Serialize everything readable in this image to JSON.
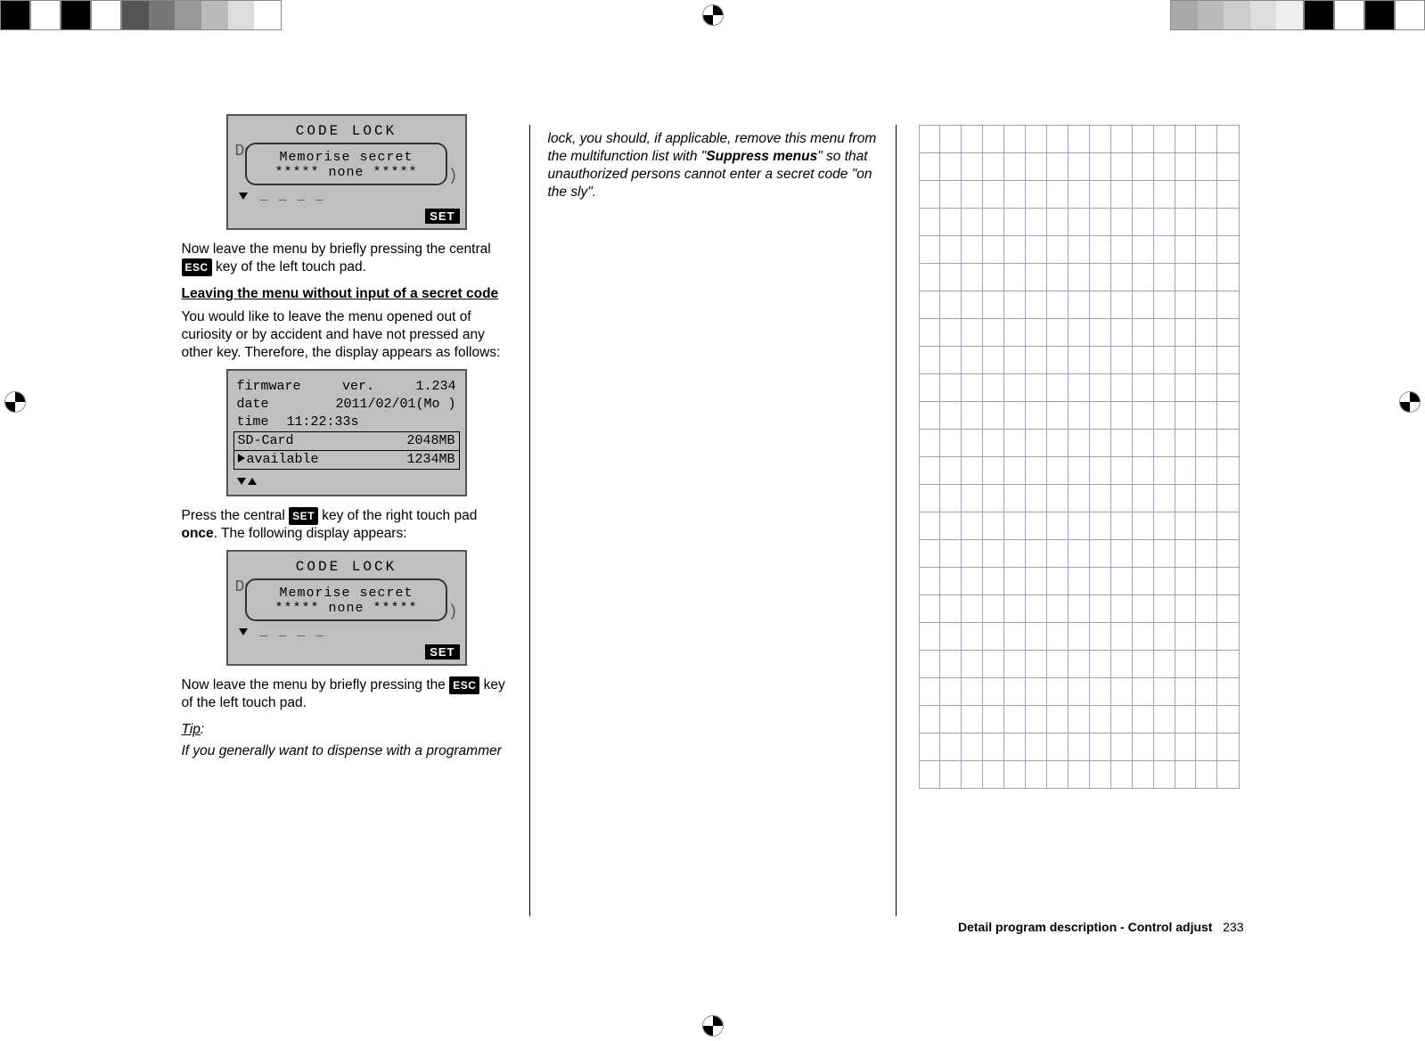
{
  "lcd_codelock1": {
    "header": "CODE  LOCK",
    "bg_left": "De",
    "bg_right": ")",
    "popup_line1": "Memorise secret",
    "popup_line2": "***** none *****",
    "underscores": "_ _ _ _",
    "set_label": "SET"
  },
  "para1_pre": "Now leave the menu by briefly pressing the central ",
  "esc_key": "ESC",
  "para1_post": " key of the left touch pad.",
  "heading1": "Leaving the menu without input of a secret code",
  "para2": "You would like to leave the menu opened out of curiosity or by accident and have not pressed any other key. Therefore, the display appears as follows:",
  "lcd_info": {
    "rows": [
      {
        "label": "firmware",
        "mid": "ver.",
        "val": "1.234"
      },
      {
        "label": "date",
        "mid": "",
        "val": "2011/02/01(Mo )"
      },
      {
        "label": "time",
        "mid": "",
        "val": "11:22:33s"
      },
      {
        "label": "SD-Card",
        "mid": "",
        "val": "2048MB"
      },
      {
        "label": "available",
        "mid": "",
        "val": "1234MB"
      }
    ]
  },
  "para3_pre": "Press the central ",
  "set_key": "SET",
  "para3_mid": " key of the right touch pad ",
  "para3_once": "once",
  "para3_post": ". The following display appears:",
  "lcd_codelock2": {
    "header": "CODE  LOCK",
    "bg_left": "De",
    "bg_right": ")",
    "popup_line1": "Memorise secret",
    "popup_line2": "***** none *****",
    "underscores": "_ _ _ _",
    "set_label": "SET"
  },
  "para4_pre": "Now leave the menu by briefly pressing the ",
  "para4_post": " key of the left touch pad.",
  "tip_label": "Tip",
  "tip_colon": ":",
  "tip_text": "If you generally want to dispense with a programmer ",
  "col2_pre": "lock, you should, if applicable, remove this menu from the multifunction list with \"",
  "col2_bold": "Suppress menus",
  "col2_post": "\" so that unauthorized persons cannot enter a secret code \"on the sly\".",
  "footer_text": "Detail program description - Control adjust",
  "footer_page": "233"
}
